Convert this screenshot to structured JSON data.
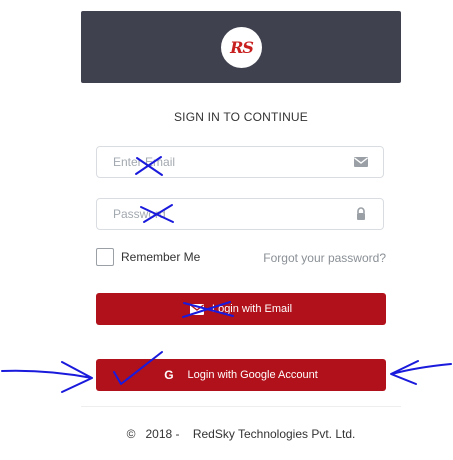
{
  "logo": {
    "text": "RS"
  },
  "heading": "SIGN IN TO CONTINUE",
  "email_field": {
    "placeholder": "Enter Email",
    "icon": "envelope-icon"
  },
  "password_field": {
    "placeholder": "Password",
    "icon": "lock-icon"
  },
  "remember": {
    "label": "Remember Me",
    "checked": false
  },
  "forgot_link": "Forgot your password?",
  "email_login_button": {
    "label": "Login with Email",
    "icon": "envelope-icon"
  },
  "google_login_button": {
    "label": "Login with Google Account",
    "icon": "G"
  },
  "footer": {
    "text": "©   2018 -    RedSky Technologies Pvt. Ltd."
  },
  "colors": {
    "header_bg": "#3f414f",
    "brand_red": "#b1111a",
    "annotation_blue": "#1a1adc"
  }
}
